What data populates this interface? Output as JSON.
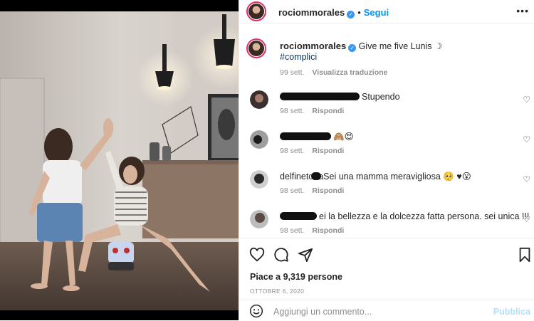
{
  "post": {
    "username": "rociommorales",
    "follow_label": "Segui",
    "separator": "•",
    "more_label": "•••",
    "caption_text": "Give me five Lunis ☽",
    "hashtag": "#complici",
    "caption_age": "99 sett.",
    "translate_label": "Visualizza traduzione"
  },
  "comments": [
    {
      "visible_prefix": "",
      "text": "Stupendo",
      "age": "98 sett.",
      "reply": "Rispondi"
    },
    {
      "visible_prefix": "",
      "text": "🙈😍",
      "age": "98 sett.",
      "reply": "Rispondi"
    },
    {
      "visible_prefix": "delfinetoria",
      "text": "Sei una mamma meravigliosa 🥺 ♥😮",
      "age": "98 sett.",
      "reply": "Rispondi"
    },
    {
      "visible_prefix": "",
      "text": "ei la bellezza e la dolcezza fatta persona. sei unica !!!",
      "age": "98 sett.",
      "reply": "Rispondi"
    }
  ],
  "footer": {
    "likes": "Piace a 9,319 persone",
    "date": "OTTOBRE 6, 2020",
    "comment_placeholder": "Aggiungi un commento...",
    "publish": "Pubblica"
  },
  "colors": {
    "accent": "#0095f6",
    "verified": "#3897f0",
    "hashtag": "#00376b",
    "muted": "#8e8e8e",
    "publish_disabled": "#b2dffc"
  },
  "icons": [
    "verified-icon",
    "more-options-icon",
    "heart-icon",
    "comment-icon",
    "share-icon",
    "bookmark-icon",
    "emoji-icon"
  ]
}
